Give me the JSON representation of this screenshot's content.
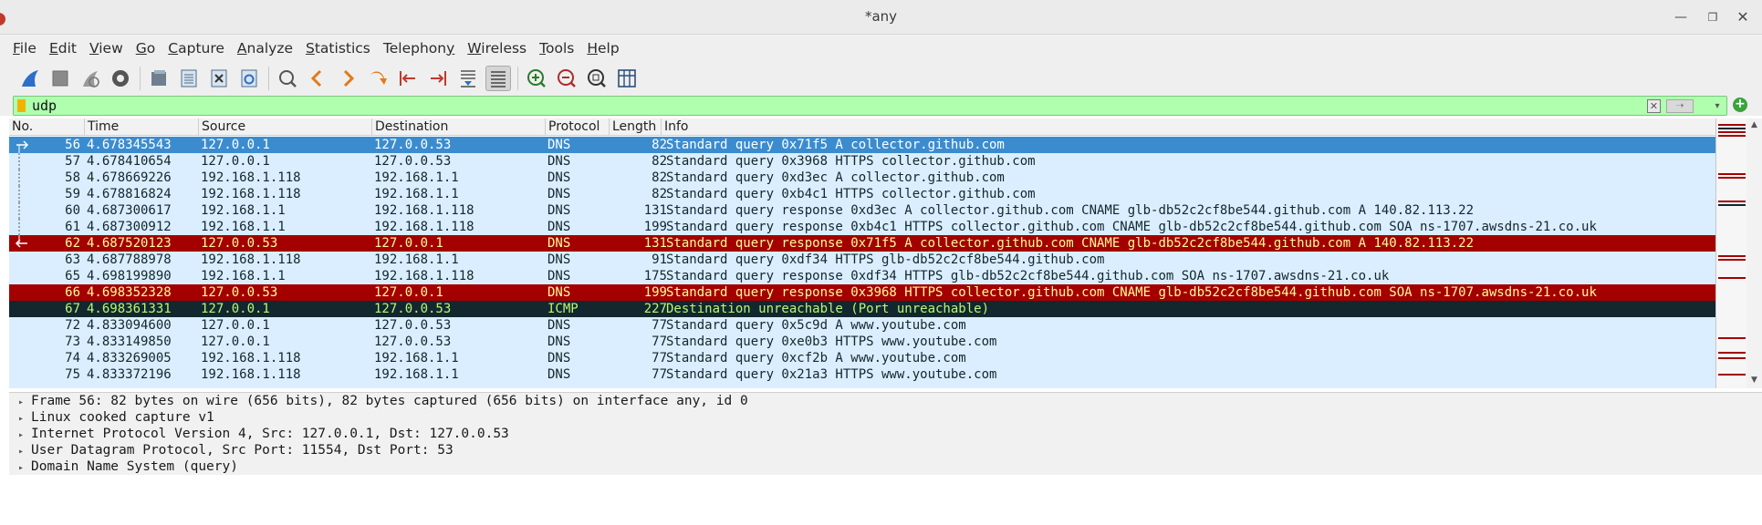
{
  "window": {
    "title": "*any"
  },
  "menu": {
    "items": [
      {
        "label": "File",
        "accel": "F",
        "rest": "ile"
      },
      {
        "label": "Edit",
        "accel": "E",
        "rest": "dit"
      },
      {
        "label": "View",
        "accel": "V",
        "rest": "iew"
      },
      {
        "label": "Go",
        "accel": "G",
        "rest": "o"
      },
      {
        "label": "Capture",
        "accel": "C",
        "rest": "apture"
      },
      {
        "label": "Analyze",
        "accel": "A",
        "rest": "nalyze"
      },
      {
        "label": "Statistics",
        "accel": "S",
        "rest": "tatistics"
      },
      {
        "label": "Telephony",
        "accel": "y",
        "prefix": "Telephon",
        "rest": ""
      },
      {
        "label": "Wireless",
        "accel": "W",
        "rest": "ireless"
      },
      {
        "label": "Tools",
        "accel": "T",
        "rest": "ools"
      },
      {
        "label": "Help",
        "accel": "H",
        "rest": "elp"
      }
    ]
  },
  "toolbar": {
    "buttons": [
      "shark-fin-icon",
      "stop-icon",
      "restart-icon",
      "capture-options-icon",
      "open-file-icon",
      "save-file-icon",
      "close-file-icon",
      "reload-icon",
      "find-packet-icon",
      "go-back-icon",
      "go-forward-icon",
      "go-to-packet-icon",
      "first-packet-icon",
      "last-packet-icon",
      "autoscroll-icon",
      "colorize-icon",
      "zoom-in-icon",
      "zoom-out-icon",
      "normal-size-icon",
      "resize-columns-icon"
    ]
  },
  "filter": {
    "value": "udp"
  },
  "packet_list": {
    "columns": [
      "No.",
      "Time",
      "Source",
      "Destination",
      "Protocol",
      "Length",
      "Info"
    ],
    "rows": [
      {
        "no": "56",
        "time": "4.678345543",
        "src": "127.0.0.1",
        "dst": "127.0.0.53",
        "proto": "DNS",
        "len": "82",
        "info": "Standard query 0x71f5 A collector.github.com",
        "style": "selected"
      },
      {
        "no": "57",
        "time": "4.678410654",
        "src": "127.0.0.1",
        "dst": "127.0.0.53",
        "proto": "DNS",
        "len": "82",
        "info": "Standard query 0x3968 HTTPS collector.github.com",
        "style": "udp"
      },
      {
        "no": "58",
        "time": "4.678669226",
        "src": "192.168.1.118",
        "dst": "192.168.1.1",
        "proto": "DNS",
        "len": "82",
        "info": "Standard query 0xd3ec A collector.github.com",
        "style": "udp"
      },
      {
        "no": "59",
        "time": "4.678816824",
        "src": "192.168.1.118",
        "dst": "192.168.1.1",
        "proto": "DNS",
        "len": "82",
        "info": "Standard query 0xb4c1 HTTPS collector.github.com",
        "style": "udp"
      },
      {
        "no": "60",
        "time": "4.687300617",
        "src": "192.168.1.1",
        "dst": "192.168.1.118",
        "proto": "DNS",
        "len": "131",
        "info": "Standard query response 0xd3ec A collector.github.com CNAME glb-db52c2cf8be544.github.com A 140.82.113.22",
        "style": "udp"
      },
      {
        "no": "61",
        "time": "4.687300912",
        "src": "192.168.1.1",
        "dst": "192.168.1.118",
        "proto": "DNS",
        "len": "199",
        "info": "Standard query response 0xb4c1 HTTPS collector.github.com CNAME glb-db52c2cf8be544.github.com SOA ns-1707.awsdns-21.co.uk",
        "style": "udp"
      },
      {
        "no": "62",
        "time": "4.687520123",
        "src": "127.0.0.53",
        "dst": "127.0.0.1",
        "proto": "DNS",
        "len": "131",
        "info": "Standard query response 0x71f5 A collector.github.com CNAME glb-db52c2cf8be544.github.com A 140.82.113.22",
        "style": "error"
      },
      {
        "no": "63",
        "time": "4.687788978",
        "src": "192.168.1.118",
        "dst": "192.168.1.1",
        "proto": "DNS",
        "len": "91",
        "info": "Standard query 0xdf34 HTTPS glb-db52c2cf8be544.github.com",
        "style": "udp"
      },
      {
        "no": "65",
        "time": "4.698199890",
        "src": "192.168.1.1",
        "dst": "192.168.1.118",
        "proto": "DNS",
        "len": "175",
        "info": "Standard query response 0xdf34 HTTPS glb-db52c2cf8be544.github.com SOA ns-1707.awsdns-21.co.uk",
        "style": "udp"
      },
      {
        "no": "66",
        "time": "4.698352328",
        "src": "127.0.0.53",
        "dst": "127.0.0.1",
        "proto": "DNS",
        "len": "199",
        "info": "Standard query response 0x3968 HTTPS collector.github.com CNAME glb-db52c2cf8be544.github.com SOA ns-1707.awsdns-21.co.uk",
        "style": "error"
      },
      {
        "no": "67",
        "time": "4.698361331",
        "src": "127.0.0.1",
        "dst": "127.0.0.53",
        "proto": "ICMP",
        "len": "227",
        "info": "Destination unreachable (Port unreachable)",
        "style": "icmp"
      },
      {
        "no": "72",
        "time": "4.833094600",
        "src": "127.0.0.1",
        "dst": "127.0.0.53",
        "proto": "DNS",
        "len": "77",
        "info": "Standard query 0x5c9d A www.youtube.com",
        "style": "udp"
      },
      {
        "no": "73",
        "time": "4.833149850",
        "src": "127.0.0.1",
        "dst": "127.0.0.53",
        "proto": "DNS",
        "len": "77",
        "info": "Standard query 0xe0b3 HTTPS www.youtube.com",
        "style": "udp"
      },
      {
        "no": "74",
        "time": "4.833269005",
        "src": "192.168.1.118",
        "dst": "192.168.1.1",
        "proto": "DNS",
        "len": "77",
        "info": "Standard query 0xcf2b A www.youtube.com",
        "style": "udp"
      },
      {
        "no": "75",
        "time": "4.833372196",
        "src": "192.168.1.118",
        "dst": "192.168.1.1",
        "proto": "DNS",
        "len": "77",
        "info": "Standard query 0x21a3 HTTPS www.youtube.com",
        "style": "udp"
      }
    ]
  },
  "details": {
    "rows": [
      "Frame 56: 82 bytes on wire (656 bits), 82 bytes captured (656 bits) on interface any, id 0",
      "Linux cooked capture v1",
      "Internet Protocol Version 4, Src: 127.0.0.1, Dst: 127.0.0.53",
      "User Datagram Protocol, Src Port: 11554, Dst Port: 53",
      "Domain Name System (query)"
    ]
  },
  "colors": {
    "selected_bg": "#3b8ccf",
    "selected_fg": "#ffffff",
    "udp_bg": "#daeeff",
    "udp_fg": "#12272e",
    "error_bg": "#a40000",
    "error_fg": "#fffc9c",
    "icmp_bg": "#12272e",
    "icmp_fg": "#b7f774",
    "filter_bg": "#afffaf"
  }
}
